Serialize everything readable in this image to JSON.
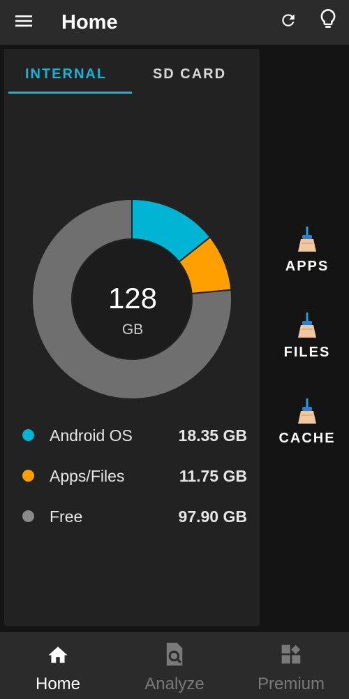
{
  "appbar": {
    "title": "Home",
    "icons": [
      "menu-icon",
      "refresh-icon",
      "lightbulb-icon"
    ]
  },
  "tabs": [
    {
      "label": "INTERNAL",
      "selected": true
    },
    {
      "label": "SD CARD",
      "selected": false
    }
  ],
  "storage": {
    "total_value": "128",
    "total_unit": "GB",
    "items": [
      {
        "name": "Android OS",
        "value": "18.35 GB",
        "color": "#00b4d4"
      },
      {
        "name": "Apps/Files",
        "value": "11.75 GB",
        "color": "#ff9f00"
      },
      {
        "name": "Free",
        "value": "97.90 GB",
        "color": "#6f6f6f"
      }
    ]
  },
  "chart_data": {
    "type": "pie",
    "categories": [
      "Android OS",
      "Apps/Files",
      "Free"
    ],
    "values": [
      18.35,
      11.75,
      97.9
    ],
    "colors": [
      "#00b4d4",
      "#ff9f00",
      "#6f6f6f"
    ],
    "title": "",
    "center_label": "128 GB"
  },
  "side_actions": [
    {
      "label": "APPS",
      "icon": "broom-icon"
    },
    {
      "label": "FILES",
      "icon": "broom-icon"
    },
    {
      "label": "CACHE",
      "icon": "broom-icon"
    }
  ],
  "bottom_nav": [
    {
      "label": "Home",
      "icon": "home-icon",
      "active": true
    },
    {
      "label": "Analyze",
      "icon": "analyze-icon",
      "active": false
    },
    {
      "label": "Premium",
      "icon": "premium-icon",
      "active": false
    }
  ],
  "colors": {
    "accent": "#1ab3d6",
    "appbar": "#2b2b2b",
    "background": "#141414",
    "panel": "#222222"
  }
}
